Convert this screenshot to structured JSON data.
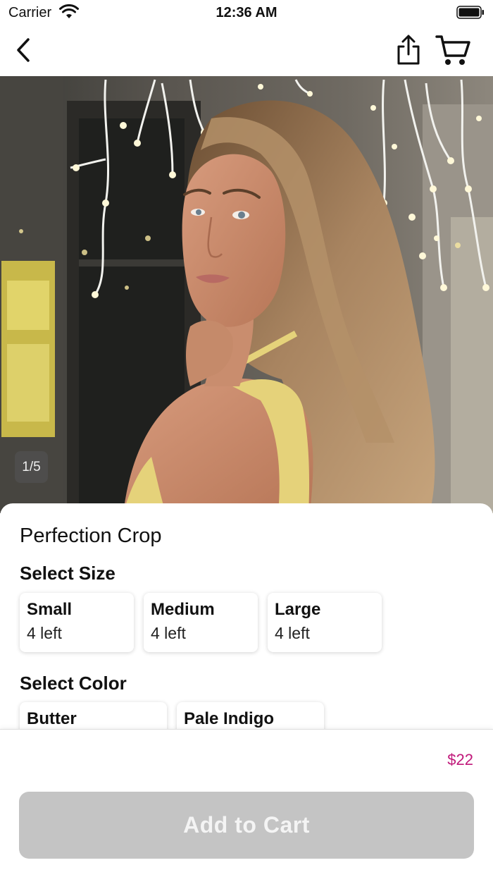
{
  "status_bar": {
    "carrier": "Carrier",
    "time": "12:36 AM"
  },
  "nav": {
    "back_icon": "chevron-left-icon",
    "share_icon": "share-icon",
    "cart_icon": "cart-icon"
  },
  "gallery": {
    "page_indicator": "1/5"
  },
  "product": {
    "name": "Perfection Crop",
    "size_section_title": "Select Size",
    "sizes": [
      {
        "label": "Small",
        "stock": "4 left"
      },
      {
        "label": "Medium",
        "stock": "4 left"
      },
      {
        "label": "Large",
        "stock": "4 left"
      }
    ],
    "color_section_title": "Select Color",
    "colors": [
      {
        "label": "Butter"
      },
      {
        "label": "Pale Indigo"
      }
    ]
  },
  "footer": {
    "price": "$22",
    "add_to_cart_label": "Add to Cart"
  },
  "colors": {
    "price_accent": "#c0187a",
    "button_disabled": "#c4c4c4"
  }
}
